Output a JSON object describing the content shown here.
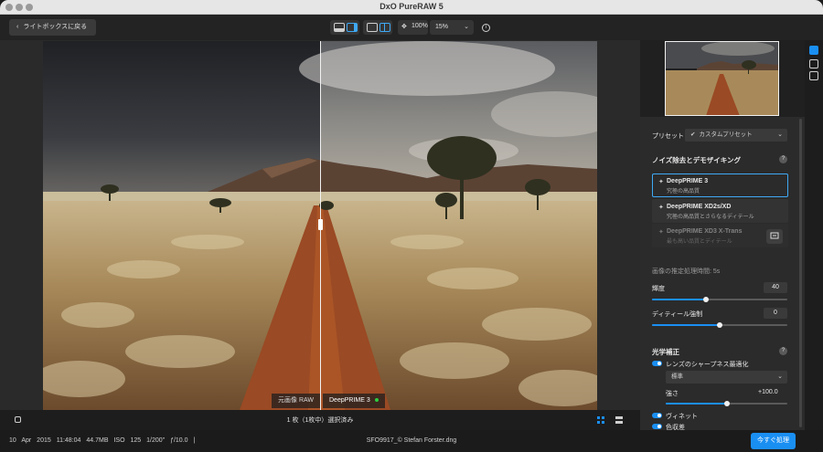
{
  "window": {
    "title": "DxO PureRAW 5"
  },
  "toolbar": {
    "back_label": "ライトボックスに戻る",
    "zoom_fixed": "100%",
    "zoom_select": "15%"
  },
  "viewer": {
    "before_label": "元画像 RAW",
    "after_label": "DeepPRIME 3",
    "selection_text": "1 枚（1枚中）選択済み"
  },
  "panel": {
    "preset_label": "プリセット",
    "preset_value": "カスタムプリセット",
    "denoise_title": "ノイズ除去とデモザイキング",
    "cards": [
      {
        "name": "DeepPRIME 3",
        "desc": "究極の高品質",
        "selected": true
      },
      {
        "name": "DeepPRIME XD2s/XD",
        "desc": "究極の高品質とさらなるディテール",
        "selected": false
      },
      {
        "name": "DeepPRIME XD3 X-Trans",
        "desc": "最も高い品質とディテール",
        "selected": false
      }
    ],
    "estimated_time": "画像の推定処理時間: 5s",
    "luminance_label": "輝度",
    "luminance_value": "40",
    "luminance_level": 0.4,
    "detail_label": "ディティール強制",
    "detail_value": "0",
    "detail_level": 0.5,
    "optics_title": "光学補正",
    "lens_sharpness_label": "レンズのシャープネス最適化",
    "lens_sharpness_mode": "標準",
    "strength_label": "強さ",
    "strength_value": "+100.0",
    "strength_level": 0.5,
    "vignette_label": "ヴィネット",
    "chromatic_label": "色収差"
  },
  "status": {
    "date": "10 Apr 2015 11:48:04",
    "size": "44.7MB",
    "iso": "ISO 125",
    "shutter": "1/200\"",
    "aperture": "ƒ/10.0",
    "separator": "|",
    "filename": "SFO9917_© Stefan Forster.dng",
    "process_button": "今すぐ処理"
  },
  "colors": {
    "accent": "#1a8ff2",
    "status_ok": "#2ecc40"
  }
}
